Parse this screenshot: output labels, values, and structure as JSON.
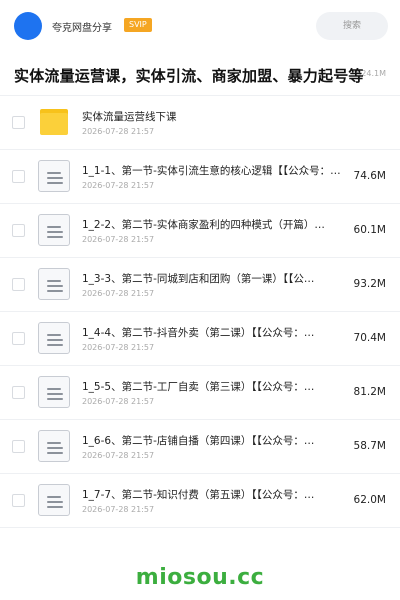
{
  "header": {
    "avatar_color": "#1e73f0",
    "user_name": "夸克网盘分享",
    "badge": "SVIP",
    "search_label": "搜索"
  },
  "share": {
    "title": "实体流量运营课，实体引流、商家加盟、暴力起号等",
    "total_size": "524.1M"
  },
  "items": [
    {
      "type": "folder",
      "icon": "folder-icon",
      "name": "实体流量运营线下课",
      "date": "2026-07-28 21:57",
      "size": ""
    },
    {
      "type": "file",
      "icon": "document-icon",
      "name": "1_1-1、第一节-实体引流生意的核心逻辑【【公众号：…",
      "date": "2026-07-28 21:57",
      "size": "74.6M"
    },
    {
      "type": "file",
      "icon": "document-icon",
      "name": "1_2-2、第二节-实体商家盈利的四种模式（开篇）…",
      "date": "2026-07-28 21:57",
      "size": "60.1M"
    },
    {
      "type": "file",
      "icon": "document-icon",
      "name": "1_3-3、第二节-同城到店和团购（第一课）【【公…",
      "date": "2026-07-28 21:57",
      "size": "93.2M"
    },
    {
      "type": "file",
      "icon": "document-icon",
      "name": "1_4-4、第二节-抖音外卖（第二课）【【公众号：…",
      "date": "2026-07-28 21:57",
      "size": "70.4M"
    },
    {
      "type": "file",
      "icon": "document-icon",
      "name": "1_5-5、第二节-工厂自卖（第三课）【【公众号：…",
      "date": "2026-07-28 21:57",
      "size": "81.2M"
    },
    {
      "type": "file",
      "icon": "document-icon",
      "name": "1_6-6、第二节-店铺自播（第四课）【【公众号：…",
      "date": "2026-07-28 21:57",
      "size": "58.7M"
    },
    {
      "type": "file",
      "icon": "document-icon",
      "name": "1_7-7、第二节-知识付费（第五课）【【公众号：…",
      "date": "2026-07-28 21:57",
      "size": "62.0M"
    }
  ],
  "footer": {
    "watermark": "miosou.cc",
    "watermark_color": "#3cae3f"
  }
}
